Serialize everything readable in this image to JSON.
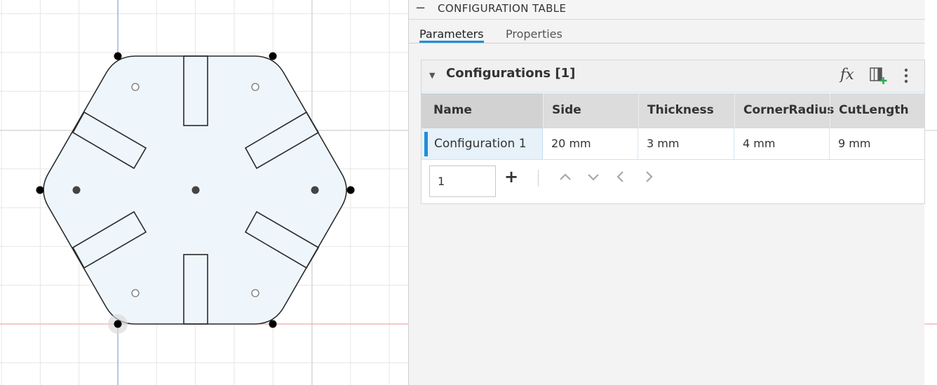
{
  "panel": {
    "collapse_symbol": "−",
    "title": "CONFIGURATION TABLE",
    "tabs": [
      {
        "label": "Parameters",
        "active": true
      },
      {
        "label": "Properties",
        "active": false
      }
    ]
  },
  "configurations": {
    "caret": "▼",
    "title": "Configurations [1]",
    "fx_label": "fx",
    "columns": [
      "Name",
      "Side",
      "Thickness",
      "CornerRadius",
      "CutLength"
    ],
    "rows": [
      {
        "name": "Configuration 1",
        "side": "20 mm",
        "thickness": "3 mm",
        "corner_radius": "4 mm",
        "cut_length": "9 mm"
      }
    ],
    "count_value": "1",
    "add_symbol": "+"
  },
  "colors": {
    "accent": "#1f8fd6",
    "sketch_fill": "#eef6fc",
    "sketch_line": "#2a2a2a",
    "grid_line": "#e6e6e6",
    "x_axis": "#f2a9a9",
    "y_axis": "#8f9bdd",
    "add_icon_green": "#2fa84f"
  },
  "icons": {
    "fx": "function-icon",
    "add_column": "add-column-icon",
    "more": "more-options-icon",
    "nav": [
      "chevron-up-icon",
      "chevron-down-icon",
      "chevron-left-icon",
      "chevron-right-icon"
    ]
  }
}
